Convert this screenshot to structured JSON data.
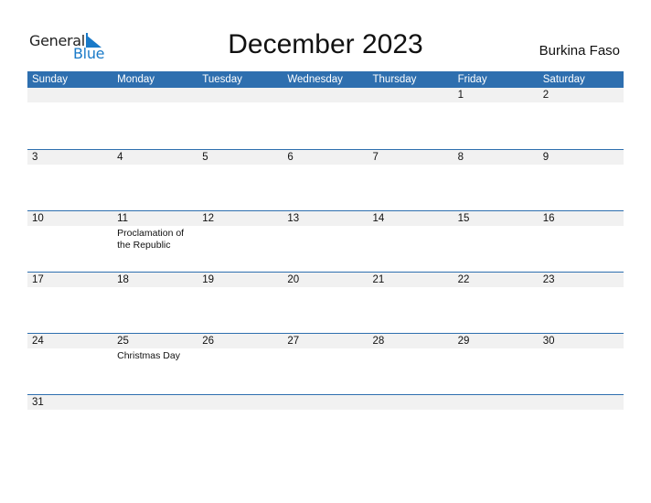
{
  "logo": {
    "word1": "General",
    "word2": "Blue"
  },
  "title": "December 2023",
  "country": "Burkina Faso",
  "colors": {
    "header": "#2e6faf",
    "strip": "#f1f1f1",
    "logo_blue": "#1a7ac8"
  },
  "weekdays": [
    "Sunday",
    "Monday",
    "Tuesday",
    "Wednesday",
    "Thursday",
    "Friday",
    "Saturday"
  ],
  "weeks": [
    [
      {
        "d": ""
      },
      {
        "d": ""
      },
      {
        "d": ""
      },
      {
        "d": ""
      },
      {
        "d": ""
      },
      {
        "d": "1"
      },
      {
        "d": "2"
      }
    ],
    [
      {
        "d": "3"
      },
      {
        "d": "4"
      },
      {
        "d": "5"
      },
      {
        "d": "6"
      },
      {
        "d": "7"
      },
      {
        "d": "8"
      },
      {
        "d": "9"
      }
    ],
    [
      {
        "d": "10"
      },
      {
        "d": "11",
        "e": "Proclamation of the Republic"
      },
      {
        "d": "12"
      },
      {
        "d": "13"
      },
      {
        "d": "14"
      },
      {
        "d": "15"
      },
      {
        "d": "16"
      }
    ],
    [
      {
        "d": "17"
      },
      {
        "d": "18"
      },
      {
        "d": "19"
      },
      {
        "d": "20"
      },
      {
        "d": "21"
      },
      {
        "d": "22"
      },
      {
        "d": "23"
      }
    ],
    [
      {
        "d": "24"
      },
      {
        "d": "25",
        "e": "Christmas Day"
      },
      {
        "d": "26"
      },
      {
        "d": "27"
      },
      {
        "d": "28"
      },
      {
        "d": "29"
      },
      {
        "d": "30"
      }
    ],
    [
      {
        "d": "31"
      },
      {
        "d": ""
      },
      {
        "d": ""
      },
      {
        "d": ""
      },
      {
        "d": ""
      },
      {
        "d": ""
      },
      {
        "d": ""
      }
    ]
  ]
}
